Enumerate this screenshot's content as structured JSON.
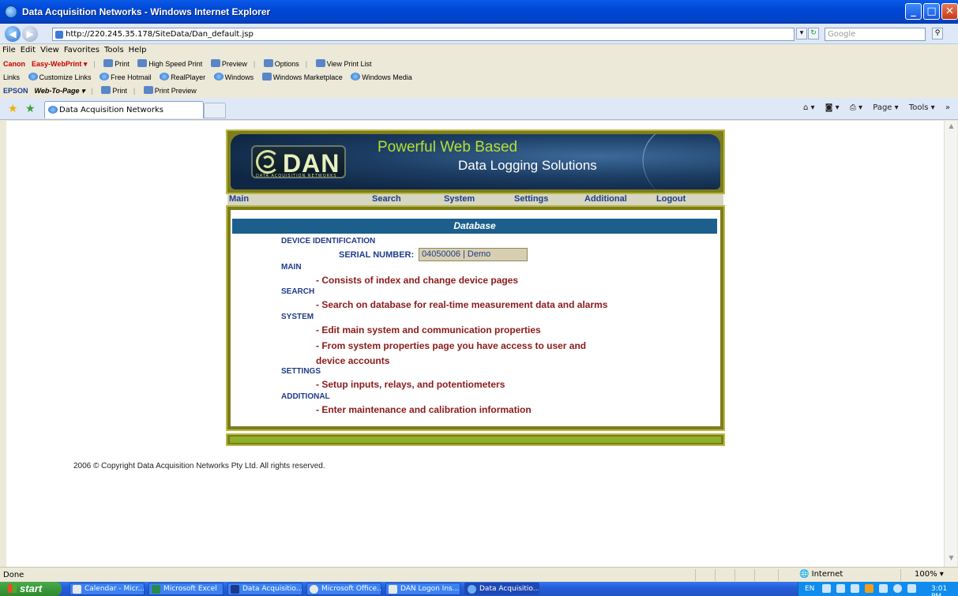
{
  "window": {
    "title": "Data Acquisition Networks - Windows Internet Explorer",
    "minimize": "_",
    "maximize": "□",
    "close": "✕"
  },
  "address_bar": {
    "url": "http://220.245.35.178/SiteData/Dan_default.jsp",
    "search_placeholder": "Google"
  },
  "menu": [
    "File",
    "Edit",
    "View",
    "Favorites",
    "Tools",
    "Help"
  ],
  "canon_toolbar": {
    "brand": "Canon",
    "product": "Easy-WebPrint ▾",
    "items": [
      "Print",
      "High Speed Print",
      "Preview",
      "Options",
      "View Print List"
    ]
  },
  "links_toolbar": {
    "label": "Links",
    "items": [
      "Customize Links",
      "Free Hotmail",
      "RealPlayer",
      "Windows",
      "Windows Marketplace",
      "Windows Media"
    ]
  },
  "epson_toolbar": {
    "brand": "EPSON",
    "product": "Web-To-Page ▾",
    "items": [
      "Print",
      "Print Preview"
    ]
  },
  "tab": {
    "label": "Data Acquisition Networks"
  },
  "command_bar": [
    "Page ▾",
    "Tools ▾"
  ],
  "site": {
    "logo_text": "DAN",
    "logo_subtext": "DATA ACQUISITION NETWORKS",
    "slogan_line1": "Powerful Web Based",
    "slogan_line2": "Data Logging Solutions",
    "nav": [
      "Main",
      "Search",
      "System",
      "Settings",
      "Additional",
      "Logout"
    ],
    "section_header": "Database",
    "device_identification": "DEVICE IDENTIFICATION",
    "serial_label": "SERIAL NUMBER:",
    "serial_value": "04050006 | Demo",
    "sections": [
      {
        "title": "MAIN",
        "lines": [
          "- Consists of index and change device pages"
        ]
      },
      {
        "title": "SEARCH",
        "lines": [
          "- Search on database for real-time measurement data and alarms"
        ]
      },
      {
        "title": "SYSTEM",
        "lines": [
          "- Edit main system and communication properties",
          "- From system properties page you have access to user and",
          "device accounts"
        ]
      },
      {
        "title": "SETTINGS",
        "lines": [
          "- Setup inputs, relays, and potentiometers"
        ]
      },
      {
        "title": "ADDITIONAL",
        "lines": [
          "- Enter maintenance and calibration information"
        ]
      }
    ],
    "copyright": "2006 © Copyright Data Acquisition Networks Pty Ltd. All rights reserved."
  },
  "status_bar": {
    "status": "Done",
    "zone": "Internet",
    "zoom": "100%"
  },
  "taskbar": {
    "start": "start",
    "items": [
      "Calendar - Micr...",
      "Microsoft Excel",
      "Data Acquisitio...",
      "Microsoft Office...",
      "DAN Logon Ins...",
      "Data Acquisitio..."
    ],
    "language": "EN",
    "clock": "3:01 PM"
  }
}
